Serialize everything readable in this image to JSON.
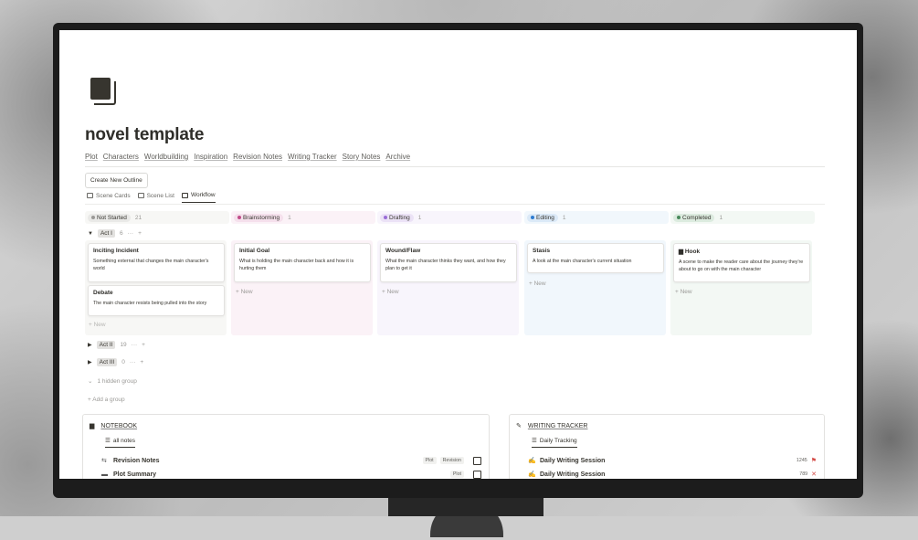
{
  "page": {
    "title": "novel template",
    "nav_links": [
      "Plot",
      "Characters",
      "Worldbuilding",
      "Inspiration",
      "Revision Notes",
      "Writing Tracker",
      "Story Notes",
      "Archive"
    ],
    "create_button": "Create New Outline",
    "views": [
      {
        "label": "Scene Cards",
        "active": false
      },
      {
        "label": "Scene List",
        "active": false
      },
      {
        "label": "Workflow",
        "active": true
      }
    ]
  },
  "board": {
    "columns": [
      {
        "label": "Not Started",
        "count": "21",
        "color": "#9b9a97",
        "pill_bg": "#e9e9e7",
        "lane_bg": "#f7f7f5"
      },
      {
        "label": "Brainstorming",
        "count": "1",
        "color": "#c14c8a",
        "pill_bg": "#f5e0ec",
        "lane_bg": "#fbf2f7"
      },
      {
        "label": "Drafting",
        "count": "1",
        "color": "#9a6dd7",
        "pill_bg": "#ebe2f6",
        "lane_bg": "#f8f5fc"
      },
      {
        "label": "Editing",
        "count": "1",
        "color": "#2e7cd1",
        "pill_bg": "#dbe9f7",
        "lane_bg": "#f1f7fc"
      },
      {
        "label": "Completed",
        "count": "1",
        "color": "#4a8a5c",
        "pill_bg": "#dcebdf",
        "lane_bg": "#f3f8f4"
      }
    ],
    "groups": [
      {
        "label": "Act I",
        "count": "6",
        "expanded": true
      },
      {
        "label": "Act II",
        "count": "19",
        "expanded": false
      },
      {
        "label": "Act III",
        "count": "0",
        "expanded": false
      }
    ],
    "cards": {
      "c0a": {
        "title": "Inciting Incident",
        "desc": "Something external that changes the main character's world"
      },
      "c0b": {
        "title": "Debate",
        "desc": "The main character resists being pulled into the story"
      },
      "c1": {
        "title": "Initial Goal",
        "desc": "What is holding the main character back and how it is hurting them"
      },
      "c2": {
        "title": "Wound/Flaw",
        "desc": "What the main character thinks they want, and how they plan to get it"
      },
      "c3": {
        "title": "Stasis",
        "desc": "A look at the main character's current situation"
      },
      "c4": {
        "title": "Hook",
        "desc": "A scene to make the reader care about the journey they're about to go on with the main character"
      }
    },
    "new_label": "+ New",
    "more_glyph": "···",
    "add_glyph": "+",
    "hidden_group": "1 hidden group",
    "add_group": "+ Add a group"
  },
  "notebook": {
    "title": "NOTEBOOK",
    "view": "all notes",
    "rows": [
      {
        "name": "Revision Notes",
        "tags": [
          "Plot",
          "Revision"
        ]
      },
      {
        "name": "Plot Summary",
        "tags": [
          "Plot"
        ]
      }
    ]
  },
  "tracker": {
    "title": "WRITING TRACKER",
    "view": "Daily Tracking",
    "rows": [
      {
        "name": "Daily Writing Session",
        "count": "1245",
        "status_glyph": "⚑",
        "status_color": "#d44c47"
      },
      {
        "name": "Daily Writing Session",
        "count": "789",
        "status_glyph": "✕",
        "status_color": "#d44c47"
      }
    ]
  }
}
